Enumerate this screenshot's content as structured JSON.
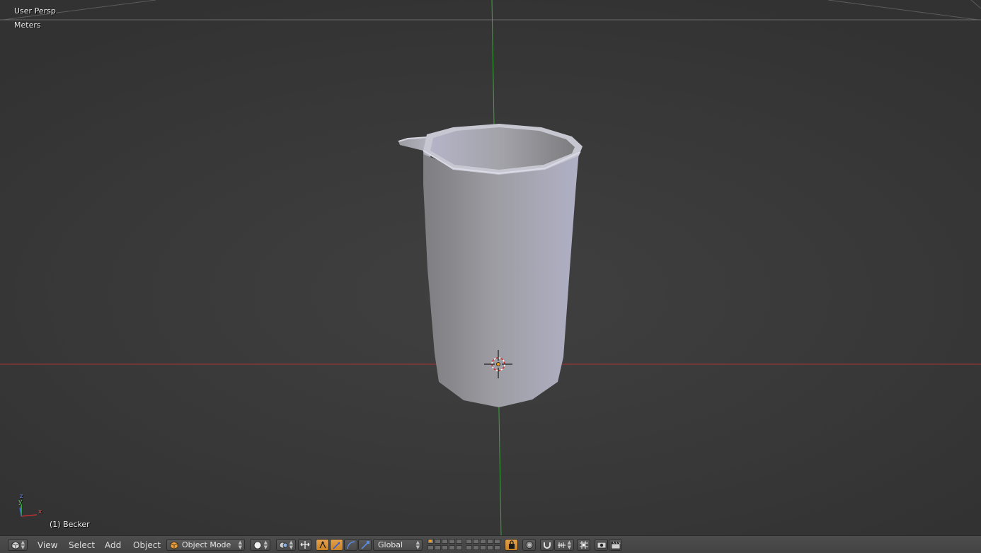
{
  "viewport": {
    "view_name": "User Persp",
    "units": "Meters",
    "object_info": "(1) Becker",
    "axis_colors": {
      "x": "#c03030",
      "y": "#3cc03c",
      "z": "#3a5ed8"
    },
    "axis_labels": {
      "x": "x",
      "y": "y",
      "z": "z"
    },
    "object_icon": "beaker-mesh"
  },
  "header": {
    "editor_type_icon": "3d-viewport-icon",
    "menus": {
      "view": "View",
      "select": "Select",
      "add": "Add",
      "object": "Object"
    },
    "mode": {
      "label": "Object Mode",
      "icon": "object-mode-cube-icon"
    },
    "viewport_shading_icon": "solid-sphere-icon",
    "pivot_icon": "pivot-point-icon",
    "transform_orientation": "Global",
    "accent_color": "#e09a3e"
  }
}
